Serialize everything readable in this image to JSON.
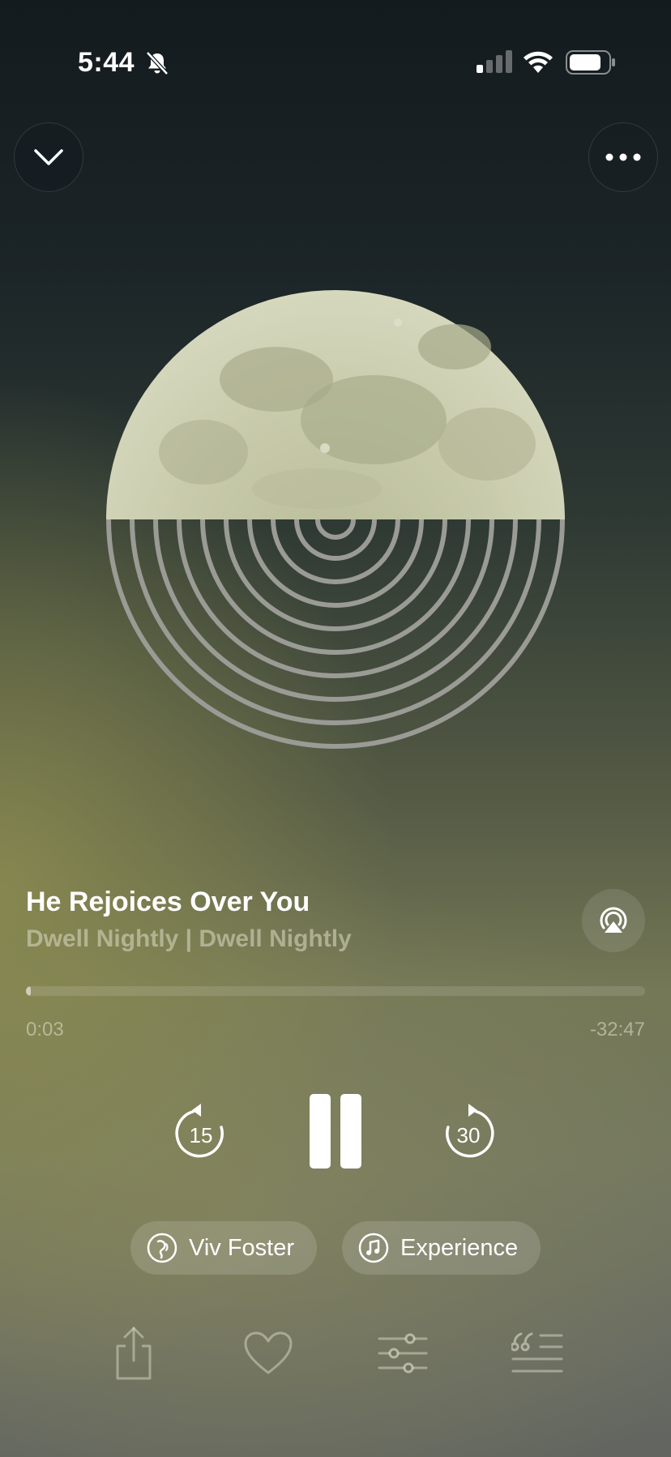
{
  "status_bar": {
    "time": "5:44"
  },
  "header": {
    "collapse_icon": "chevron-down-icon",
    "more_icon": "ellipsis-icon"
  },
  "track": {
    "title": "He Rejoices Over You",
    "subtitle": "Dwell Nightly | Dwell Nightly",
    "elapsed": "0:03",
    "remaining": "-32:47",
    "progress": 0.002
  },
  "controls": {
    "skip_back_seconds": "15",
    "skip_forward_seconds": "30"
  },
  "chips": {
    "voice_label": "Viv Foster",
    "experience_label": "Experience"
  },
  "colors": {
    "moon": "#c9ccac",
    "rings": "#9a9b95"
  }
}
